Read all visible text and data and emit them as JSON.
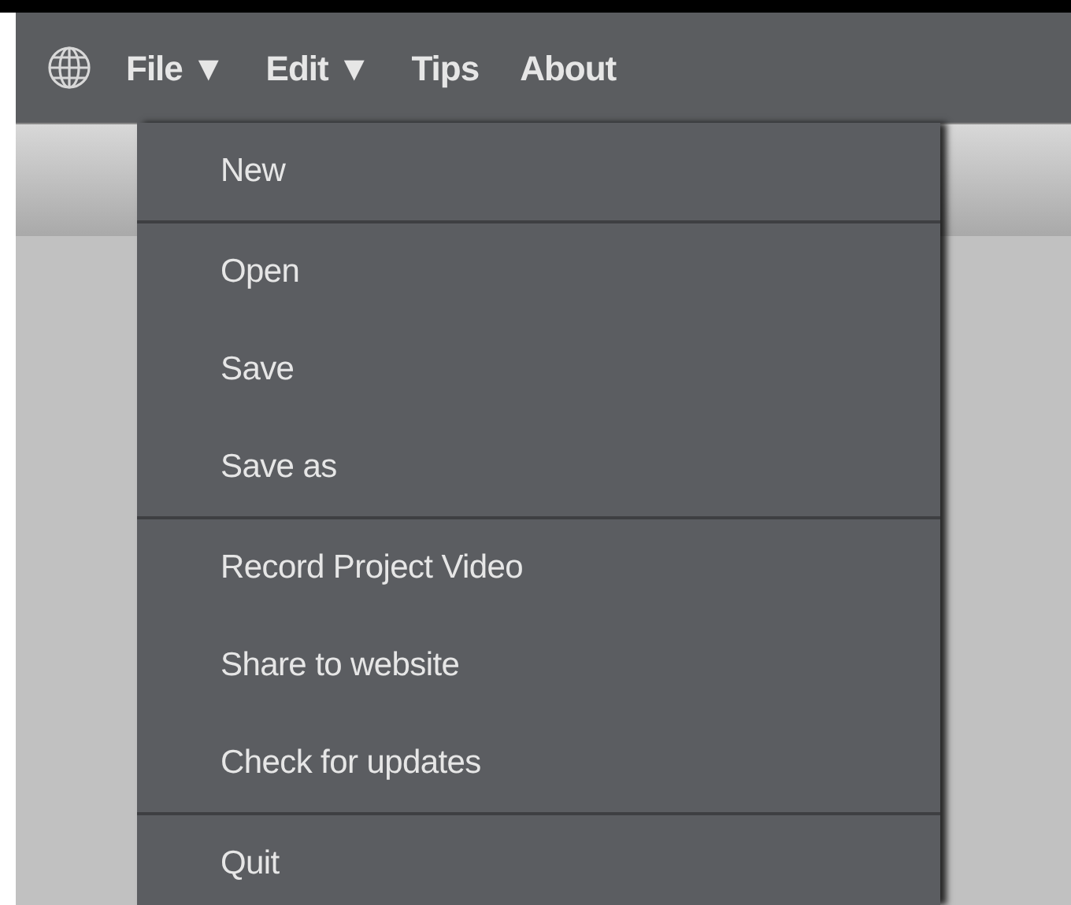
{
  "menubar": {
    "items": [
      {
        "label": "File",
        "caret": "▼"
      },
      {
        "label": "Edit",
        "caret": "▼"
      },
      {
        "label": "Tips"
      },
      {
        "label": "About"
      }
    ]
  },
  "file_menu": {
    "groups": [
      [
        "New"
      ],
      [
        "Open",
        "Save",
        "Save as"
      ],
      [
        "Record Project Video",
        "Share to website",
        "Check for updates"
      ],
      [
        "Quit"
      ]
    ]
  }
}
